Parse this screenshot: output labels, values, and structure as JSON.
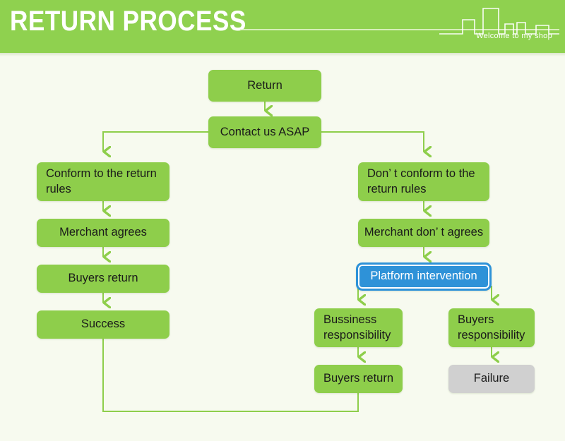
{
  "header": {
    "title": "RETURN PROCESS",
    "tagline": "Welcome to my shop",
    "skyline_icon": "city-skyline-icon",
    "bg_color": "#8fd14f",
    "text_color": "#ffffff"
  },
  "canvas": {
    "background_color": "#f7faef",
    "node_green": "#8ece4b",
    "node_blue": "#2e92d8",
    "node_gray": "#d0d0d0",
    "connector_color": "#8ece4b"
  },
  "diagram": {
    "type": "flowchart",
    "title": "RETURN PROCESS",
    "nodes": [
      {
        "id": "return",
        "label": "Return",
        "color": "green",
        "align": "center"
      },
      {
        "id": "contact",
        "label": "Contact us ASAP",
        "color": "green",
        "align": "center"
      },
      {
        "id": "conform",
        "label": "Conform to the return rules",
        "color": "green",
        "align": "left"
      },
      {
        "id": "merchant_ok",
        "label": "Merchant agrees",
        "color": "green",
        "align": "center"
      },
      {
        "id": "buyers_ret_l",
        "label": "Buyers return",
        "color": "green",
        "align": "center"
      },
      {
        "id": "success",
        "label": "Success",
        "color": "green",
        "align": "center"
      },
      {
        "id": "not_conform",
        "label": "Don’ t conform to the return rules",
        "color": "green",
        "align": "left"
      },
      {
        "id": "merchant_no",
        "label": "Merchant don’ t agrees",
        "color": "green",
        "align": "center"
      },
      {
        "id": "platform",
        "label": "Platform intervention",
        "color": "blue",
        "align": "center"
      },
      {
        "id": "business_resp",
        "label": "Bussiness responsibility",
        "color": "green",
        "align": "left"
      },
      {
        "id": "buyers_resp",
        "label": "Buyers responsibility",
        "color": "green",
        "align": "left"
      },
      {
        "id": "buyers_ret_r",
        "label": "Buyers return",
        "color": "green",
        "align": "center"
      },
      {
        "id": "failure",
        "label": "Failure",
        "color": "gray",
        "align": "center"
      }
    ],
    "edges": [
      {
        "from": "return",
        "to": "contact"
      },
      {
        "from": "contact",
        "to": "conform"
      },
      {
        "from": "contact",
        "to": "not_conform"
      },
      {
        "from": "conform",
        "to": "merchant_ok"
      },
      {
        "from": "merchant_ok",
        "to": "buyers_ret_l"
      },
      {
        "from": "buyers_ret_l",
        "to": "success"
      },
      {
        "from": "not_conform",
        "to": "merchant_no"
      },
      {
        "from": "merchant_no",
        "to": "platform"
      },
      {
        "from": "platform",
        "to": "business_resp"
      },
      {
        "from": "platform",
        "to": "buyers_resp"
      },
      {
        "from": "business_resp",
        "to": "buyers_ret_r"
      },
      {
        "from": "buyers_resp",
        "to": "failure"
      },
      {
        "from": "buyers_ret_r",
        "to": "success"
      }
    ]
  }
}
